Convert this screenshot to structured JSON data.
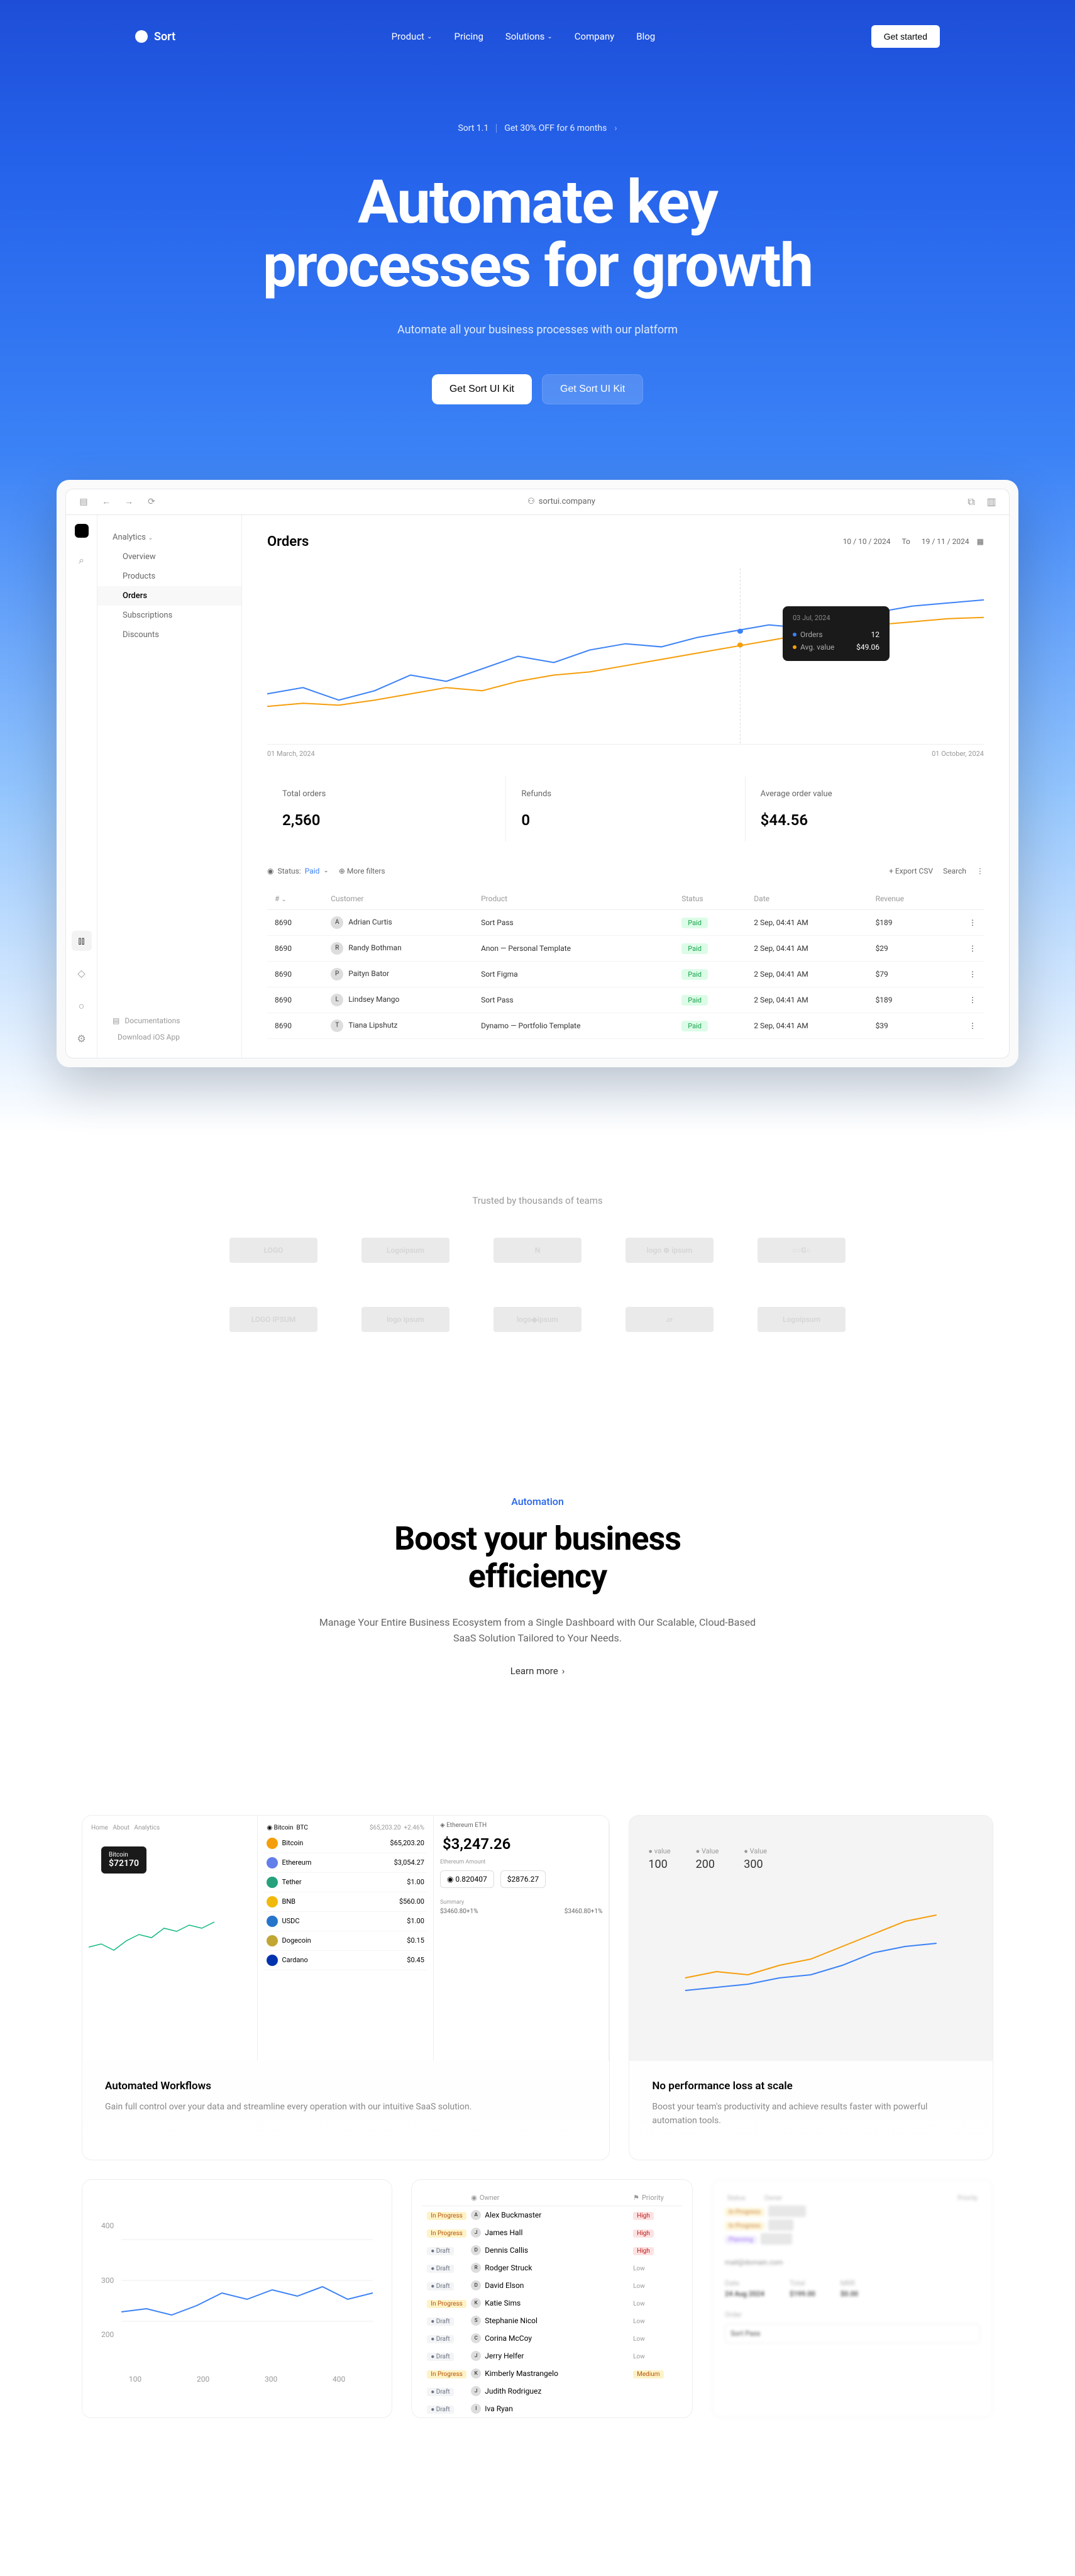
{
  "nav": {
    "logo": "Sort",
    "links": [
      "Product",
      "Pricing",
      "Solutions",
      "Company",
      "Blog"
    ],
    "cta": "Get started"
  },
  "banner": {
    "left": "Sort 1.1",
    "right": "Get 30% OFF for 6 months"
  },
  "hero": {
    "title_line1": "Automate key",
    "title_line2": "processes for growth",
    "subtitle": "Automate all your business processes with our platform",
    "cta_primary": "Get Sort UI Kit",
    "cta_secondary": "Get Sort UI Kit"
  },
  "dashboard": {
    "url": "sortui.company",
    "sidebar": {
      "top": "Analytics",
      "items": [
        "Overview",
        "Products",
        "Orders",
        "Subscriptions",
        "Discounts"
      ],
      "active_index": 2,
      "footer": [
        "Documentations",
        "Download iOS App"
      ]
    },
    "title": "Orders",
    "date_from": "10 / 10 / 2024",
    "date_to_label": "To",
    "date_to": "19 / 11 / 2024",
    "chart_dates": {
      "start": "01 March, 2024",
      "end": "01 October, 2024"
    },
    "tooltip": {
      "date": "03 Jul, 2024",
      "rows": [
        {
          "label": "Orders",
          "value": "12"
        },
        {
          "label": "Avg. value",
          "value": "$49.06"
        }
      ]
    },
    "metrics": [
      {
        "label": "Total orders",
        "value": "2,560"
      },
      {
        "label": "Refunds",
        "value": "0"
      },
      {
        "label": "Average order value",
        "value": "$44.56"
      }
    ],
    "controls": {
      "status_label": "Status:",
      "status_value": "Paid",
      "filters": "More filters",
      "export": "Export CSV",
      "search": "Search"
    },
    "table": {
      "headers": [
        "#",
        "Customer",
        "Product",
        "Status",
        "Date",
        "Revenue"
      ],
      "rows": [
        {
          "id": "8690",
          "customer": "Adrian Curtis",
          "product": "Sort Pass",
          "status": "Paid",
          "date": "2 Sep, 04:41 AM",
          "revenue": "$189"
        },
        {
          "id": "8690",
          "customer": "Randy Bothman",
          "product": "Anon — Personal Template",
          "status": "Paid",
          "date": "2 Sep, 04:41 AM",
          "revenue": "$29"
        },
        {
          "id": "8690",
          "customer": "Paityn Bator",
          "product": "Sort Figma",
          "status": "Paid",
          "date": "2 Sep, 04:41 AM",
          "revenue": "$79"
        },
        {
          "id": "8690",
          "customer": "Lindsey Mango",
          "product": "Sort Pass",
          "status": "Paid",
          "date": "2 Sep, 04:41 AM",
          "revenue": "$189"
        },
        {
          "id": "8690",
          "customer": "Tiana Lipshutz",
          "product": "Dynamo — Portfolio Template",
          "status": "Paid",
          "date": "2 Sep, 04:41 AM",
          "revenue": "$39"
        }
      ]
    }
  },
  "trusted": {
    "title": "Trusted by thousands of teams"
  },
  "automation": {
    "eyebrow": "Automation",
    "title_line1": "Boost your business",
    "title_line2": "efficiency",
    "desc": "Manage Your Entire Business Ecosystem from a Single Dashboard with Our Scalable, Cloud-Based SaaS Solution Tailored to Your Needs.",
    "learn": "Learn more"
  },
  "features": [
    {
      "title": "Automated Workflows",
      "desc": "Gain full control over your data and streamline every operation with our intuitive SaaS solution."
    },
    {
      "title": "No performance loss at scale",
      "desc": "Boost your team's productivity and achieve results faster with powerful automation tools."
    }
  ],
  "feature2_chart": {
    "legend": [
      {
        "label": "value",
        "value": "100"
      },
      {
        "label": "Value",
        "value": "200"
      },
      {
        "label": "Value",
        "value": "300"
      }
    ]
  },
  "small_chart": {
    "ticks": [
      "100",
      "200",
      "300",
      "400"
    ],
    "y_ticks": [
      "400",
      "300",
      "200"
    ]
  },
  "tasks": {
    "header": {
      "status": "",
      "owner": "Owner",
      "priority": "Priority"
    },
    "rows": [
      {
        "status": "ip",
        "owner": "Alex Buckmaster",
        "initial": "A",
        "priority": "High"
      },
      {
        "status": "ip",
        "owner": "James Hall",
        "initial": "J",
        "priority": "High"
      },
      {
        "status": "draft",
        "owner": "Dennis Callis",
        "initial": "D",
        "priority": "High"
      },
      {
        "status": "draft",
        "owner": "Rodger Struck",
        "initial": "R",
        "priority": "Low"
      },
      {
        "status": "draft",
        "owner": "David Elson",
        "initial": "D",
        "priority": "Low"
      },
      {
        "status": "ip",
        "owner": "Katie Sims",
        "initial": "K",
        "priority": "Low"
      },
      {
        "status": "draft",
        "owner": "Stephanie Nicol",
        "initial": "S",
        "priority": "Low"
      },
      {
        "status": "draft",
        "owner": "Corina McCoy",
        "initial": "C",
        "priority": "Low"
      },
      {
        "status": "draft",
        "owner": "Jerry Helfer",
        "initial": "J",
        "priority": "Low"
      },
      {
        "status": "ip",
        "owner": "Kimberly Mastrangelo",
        "initial": "K",
        "priority": "Medium"
      },
      {
        "status": "draft",
        "owner": "Judith Rodriguez",
        "initial": "J",
        "priority": ""
      },
      {
        "status": "draft",
        "owner": "Iva Ryan",
        "initial": "I",
        "priority": ""
      }
    ],
    "status_labels": {
      "ip": "In Progress",
      "draft": "Draft"
    }
  },
  "trade_widget": {
    "price": "$3,247.26",
    "prices_row": {
      "left": "0.820407",
      "right": "$2876.27"
    },
    "eth_label": "Ethereum"
  },
  "order_blur": {
    "email": "mail@domain.com",
    "date_label": "Date",
    "date": "24 Aug 2024",
    "total_label": "Total",
    "total": "$199.00",
    "mrr_label": "MRR",
    "mrr": "$0.00",
    "section": "Order",
    "item": "Sort Pass"
  },
  "chart_data": {
    "type": "line",
    "title": "Orders",
    "x_range": [
      "01 March, 2024",
      "01 October, 2024"
    ],
    "series": [
      {
        "name": "Orders",
        "color": "#3b82f6",
        "values": [
          40,
          45,
          38,
          42,
          50,
          48,
          55,
          60,
          58,
          65,
          70,
          68,
          75,
          72,
          80,
          78,
          85,
          82,
          88,
          90
        ]
      },
      {
        "name": "Avg. value",
        "color": "#f59e0b",
        "values": [
          35,
          38,
          36,
          40,
          42,
          45,
          44,
          48,
          50,
          52,
          55,
          58,
          60,
          62,
          65,
          68,
          70,
          72,
          74,
          76
        ]
      }
    ],
    "tooltip_point": {
      "date": "03 Jul, 2024",
      "orders": 12,
      "avg_value": 49.06
    }
  }
}
